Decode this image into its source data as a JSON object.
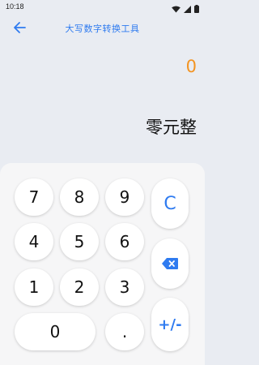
{
  "status_bar": {
    "time": "10:18"
  },
  "app_bar": {
    "title": "大写数字转换工具"
  },
  "display": {
    "number": "0",
    "chinese": "零元整"
  },
  "keypad": {
    "keys": [
      "7",
      "8",
      "9",
      "4",
      "5",
      "6",
      "1",
      "2",
      "3",
      "0",
      "."
    ],
    "clear_label": "C",
    "sign_label": "+/-"
  },
  "colors": {
    "accent": "#2f7bf0",
    "number": "#f39422",
    "background": "#e9ecf2",
    "keypad_bg": "#f6f6f7"
  }
}
